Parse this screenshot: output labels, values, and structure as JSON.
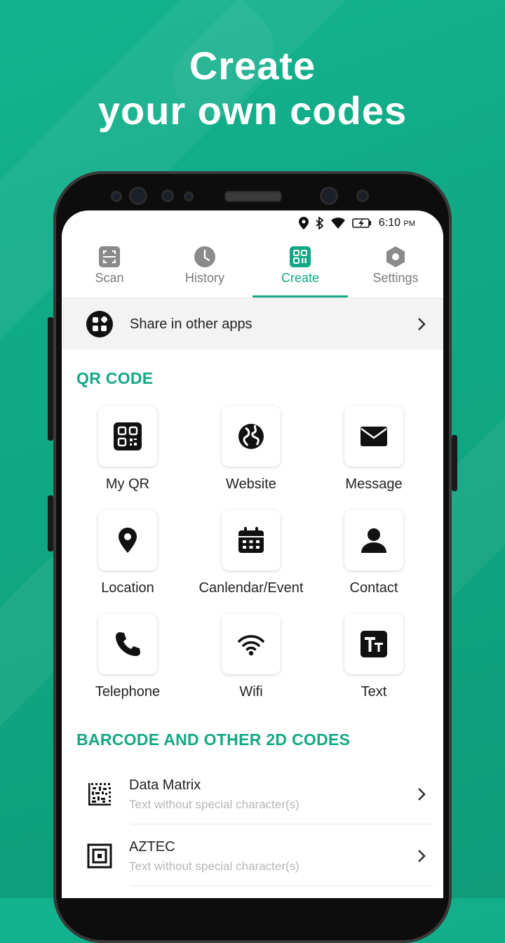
{
  "headline": {
    "line1": "Create",
    "line2": "your own codes"
  },
  "status": {
    "time": "6:10",
    "ampm": "PM"
  },
  "tabs": [
    {
      "label": "Scan",
      "icon": "scan-icon"
    },
    {
      "label": "History",
      "icon": "clock-icon"
    },
    {
      "label": "Create",
      "icon": "qr-create-icon"
    },
    {
      "label": "Settings",
      "icon": "gear-icon"
    }
  ],
  "share": {
    "label": "Share in other apps"
  },
  "qr_section": {
    "title": "QR CODE",
    "items": [
      {
        "label": "My QR",
        "icon": "my-qr-icon"
      },
      {
        "label": "Website",
        "icon": "globe-icon"
      },
      {
        "label": "Message",
        "icon": "envelope-icon"
      },
      {
        "label": "Location",
        "icon": "location-pin-icon"
      },
      {
        "label": "Canlendar/Event",
        "icon": "calendar-icon"
      },
      {
        "label": "Contact",
        "icon": "person-icon"
      },
      {
        "label": "Telephone",
        "icon": "phone-icon"
      },
      {
        "label": "Wifi",
        "icon": "wifi-icon"
      },
      {
        "label": "Text",
        "icon": "text-icon"
      }
    ]
  },
  "barcode_section": {
    "title": "BARCODE AND OTHER 2D CODES",
    "items": [
      {
        "title": "Data Matrix",
        "subtitle": "Text without special character(s)",
        "icon": "data-matrix-icon"
      },
      {
        "title": "AZTEC",
        "subtitle": "Text without special character(s)",
        "icon": "aztec-icon"
      }
    ]
  },
  "colors": {
    "accent": "#13a885",
    "background": "#10a883"
  }
}
